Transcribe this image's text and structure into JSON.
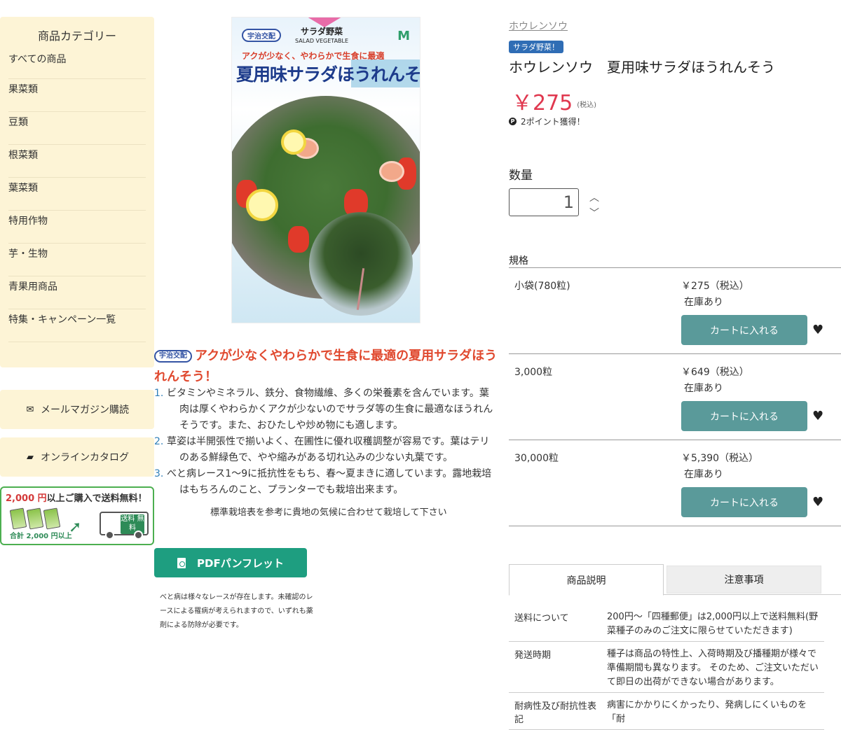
{
  "sidebar": {
    "title": "商品カテゴリー",
    "categories": [
      "すべての商品",
      "果菜類",
      "豆類",
      "根菜類",
      "葉菜類",
      "特用作物",
      "芋・生物",
      "青果用商品",
      "特集・キャンペーン一覧"
    ],
    "mail_label": "メールマガジン購読",
    "catalog_label": "オンラインカタログ",
    "banner": {
      "amount": "2,000 円",
      "text": "以上ご購入で送料無料！",
      "sub": "合計 2,000 円以上",
      "truck_text": "送料 無料"
    }
  },
  "product_image": {
    "brand": "宇治交配",
    "series": "サラダ野菜",
    "series_en": "SALAD VEGETABLE",
    "catch": "アクが少なく、やわらかで生食に最適",
    "name": "夏用味サラダほうれんそう",
    "mark": "M"
  },
  "description": {
    "badge": "宇治交配",
    "heading": "アクが少なくやわらかで生食に最適の夏用サラダほうれんそう！",
    "items": [
      {
        "num": "1.",
        "line1": "ビタミンやミネラル、鉄分、食物繊維、多くの栄養素を含んでいます。葉",
        "line2": "肉は厚くやわらかくアクが少ないのでサラダ等の生食に最適なほうれん",
        "line3": "そうです。また、おひたしや炒め物にも適します。"
      },
      {
        "num": "2.",
        "line1": "草姿は半開張性で揃いよく、在圃性に優れ収穫調整が容易です。葉はテリ",
        "line2": "のある鮮緑色で、やや縮みがある切れ込みの少ない丸葉です。",
        "line3": ""
      },
      {
        "num": "3.",
        "line1": "べと病レース1〜9に抵抗性をもち、春〜夏まきに適しています。露地栽培",
        "line2": "はもちろんのこと、プランターでも栽培出来ます。",
        "line3": ""
      }
    ],
    "note": "標準栽培表を参考に貴地の気候に合わせて栽培して下さい",
    "pdf_label": "PDFパンフレット",
    "small_note_1": "べと病は様々なレースが存在します。未確認のレ",
    "small_note_2": "ースによる罹病が考えられますので、いずれも薬",
    "small_note_3": "剤による防除が必要です。"
  },
  "product": {
    "breadcrumb": "ホウレンソウ",
    "tag": "サラダ野菜！",
    "title": "ホウレンソウ　夏用味サラダほうれんそう",
    "price": "￥275",
    "tax": "(税込)",
    "points": "2ポイント獲得！",
    "qty_label": "数量",
    "qty_value": "1",
    "spec_label": "規格",
    "specs": [
      {
        "name": "小袋(780粒)",
        "price": "￥275（税込）",
        "stock": "在庫あり"
      },
      {
        "name": "3,000粒",
        "price": "￥649（税込）",
        "stock": "在庫あり"
      },
      {
        "name": "30,000粒",
        "price": "￥5,390（税込）",
        "stock": "在庫あり"
      }
    ],
    "cart_label": "カートに入れる"
  },
  "tabs": {
    "active": "商品説明",
    "inactive": "注意事項"
  },
  "info": [
    {
      "key": "送料について",
      "val": "200円〜「四種郵便」は2,000円以上で送料無料(野菜種子のみのご注文に限らせていただきます)"
    },
    {
      "key": "発送時期",
      "val": "種子は商品の特性上、入荷時期及び播種期が様々で準備期間も異なります。 そのため、ご注文いただいて即日の出荷ができない場合があります。"
    },
    {
      "key": "耐病性及び耐抗性表記",
      "val": "病害にかかりにくかったり、発病しにくいものを「耐"
    }
  ],
  "colors": {
    "sidebar_bg": "#fdf4d6",
    "price": "#e0384f",
    "cart_button": "#5a9a9a",
    "pdf_button": "#1e9e80",
    "heading_red": "#e0492f"
  }
}
